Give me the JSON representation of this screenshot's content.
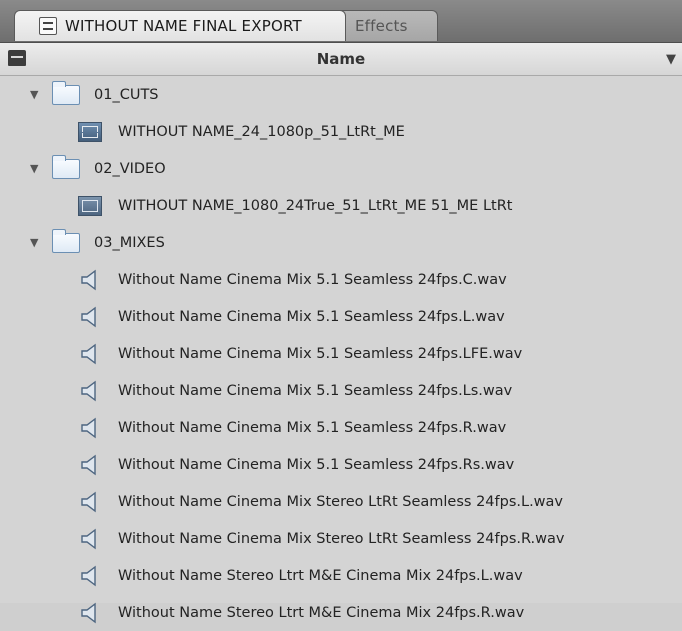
{
  "tabs": [
    {
      "label": "WITHOUT NAME FINAL EXPORT",
      "icon": "sequence-icon",
      "active": true
    },
    {
      "label": "Effects",
      "active": false
    }
  ],
  "header": {
    "column_name": "Name",
    "bin_icon": "bin-icon",
    "sort_icon": "sort-arrow-icon"
  },
  "rows": [
    {
      "type": "folder",
      "label": "01_CUTS",
      "expanded": true
    },
    {
      "type": "sequence",
      "label": "WITHOUT NAME_24_1080p_51_LtRt_ME"
    },
    {
      "type": "folder",
      "label": "02_VIDEO",
      "expanded": true
    },
    {
      "type": "video",
      "label": "WITHOUT NAME_1080_24True_51_LtRt_ME 51_ME LtRt"
    },
    {
      "type": "folder",
      "label": "03_MIXES",
      "expanded": true
    },
    {
      "type": "audio",
      "label": "Without Name Cinema Mix 5.1 Seamless 24fps.C.wav"
    },
    {
      "type": "audio",
      "label": "Without Name Cinema Mix 5.1 Seamless 24fps.L.wav"
    },
    {
      "type": "audio",
      "label": "Without Name Cinema Mix 5.1 Seamless 24fps.LFE.wav"
    },
    {
      "type": "audio",
      "label": "Without Name Cinema Mix 5.1 Seamless 24fps.Ls.wav"
    },
    {
      "type": "audio",
      "label": "Without Name Cinema Mix 5.1 Seamless 24fps.R.wav"
    },
    {
      "type": "audio",
      "label": "Without Name Cinema Mix 5.1 Seamless 24fps.Rs.wav"
    },
    {
      "type": "audio",
      "label": "Without Name Cinema Mix Stereo LtRt Seamless 24fps.L.wav"
    },
    {
      "type": "audio",
      "label": "Without Name Cinema Mix Stereo LtRt Seamless 24fps.R.wav"
    },
    {
      "type": "audio",
      "label": "Without Name Stereo Ltrt M&E Cinema Mix 24fps.L.wav"
    },
    {
      "type": "audio",
      "label": "Without Name Stereo Ltrt M&E Cinema Mix 24fps.R.wav"
    }
  ]
}
